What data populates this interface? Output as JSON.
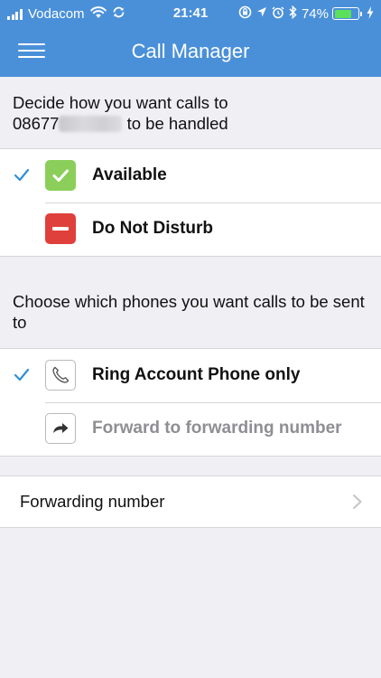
{
  "status_bar": {
    "carrier": "Vodacom",
    "time": "21:41",
    "battery_percent": "74%",
    "battery_level": 0.74,
    "icons": [
      "signal-icon",
      "wifi-icon",
      "sync-icon",
      "lock-rotation-icon",
      "location-icon",
      "alarm-icon",
      "bluetooth-icon",
      "battery-icon",
      "charging-icon"
    ]
  },
  "nav": {
    "title": "Call Manager",
    "menu_icon": "hamburger-menu-icon"
  },
  "availability": {
    "prompt_line1": "Decide how you want calls to",
    "number_visible": "08677",
    "prompt_line2_suffix": " to be handled",
    "options": [
      {
        "label": "Available",
        "selected": true,
        "icon": "checkmark-box-icon",
        "color": "#8bcf5a"
      },
      {
        "label": "Do Not Disturb",
        "selected": false,
        "icon": "minus-box-icon",
        "color": "#e0403c"
      }
    ]
  },
  "phones": {
    "prompt": "Choose which phones you want calls to be sent to",
    "options": [
      {
        "label": "Ring Account Phone only",
        "selected": true,
        "icon": "phone-icon"
      },
      {
        "label": "Forward to forwarding number",
        "selected": false,
        "icon": "forward-arrow-icon"
      }
    ]
  },
  "forwarding": {
    "label": "Forwarding number",
    "icon": "chevron-right-icon"
  },
  "colors": {
    "accent": "#4a90d9",
    "checkmark": "#2f8fd6",
    "background": "#efeff4"
  }
}
